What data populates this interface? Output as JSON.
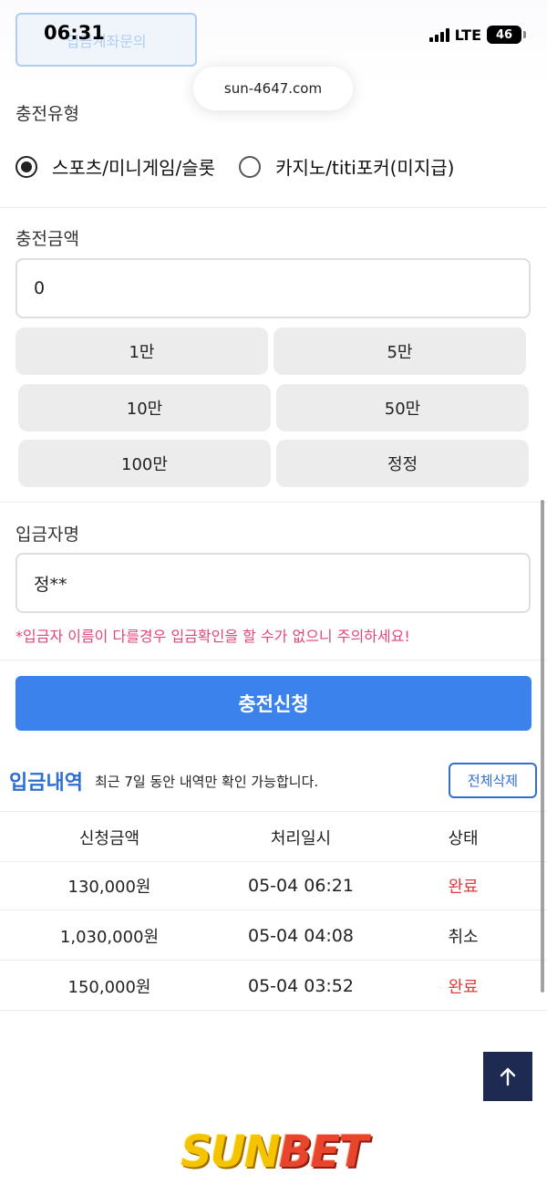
{
  "status_bar": {
    "time": "06:31",
    "network": "LTE",
    "battery": "46"
  },
  "browser": {
    "url": "sun-4647.com"
  },
  "top": {
    "account_inquiry_button": "입금계좌문의"
  },
  "charge_type": {
    "label": "충전유형",
    "options": [
      {
        "label": "스포츠/미니게임/슬롯",
        "selected": true
      },
      {
        "label": "카지노/titi포커(미지급)",
        "selected": false
      }
    ]
  },
  "charge_amount": {
    "label": "충전금액",
    "value": "0",
    "buttons": [
      "1만",
      "5만",
      "10만",
      "50만",
      "100만",
      "정정"
    ]
  },
  "depositor": {
    "label": "입금자명",
    "value": "정**",
    "warning": "*입금자 이름이 다를경우 입금확인을 할 수가 없으니 주의하세요!"
  },
  "submit_label": "충전신청",
  "history": {
    "title": "입금내역",
    "note": "최근 7일 동안 내역만 확인 가능합니다.",
    "delete_all_label": "전체삭제",
    "columns": [
      "신청금액",
      "처리일시",
      "상태"
    ],
    "rows": [
      {
        "amount": "130,000원",
        "datetime": "05-04 06:21",
        "status": "완료"
      },
      {
        "amount": "1,030,000원",
        "datetime": "05-04 04:08",
        "status": "취소"
      },
      {
        "amount": "150,000원",
        "datetime": "05-04 03:52",
        "status": "완료"
      }
    ]
  },
  "colors": {
    "accent": "#3b82ec",
    "warning": "#e0457b",
    "complete": "#e03a3a",
    "dark_button": "#1e2a52"
  },
  "footer": {
    "logo_text": "SUNBET"
  }
}
